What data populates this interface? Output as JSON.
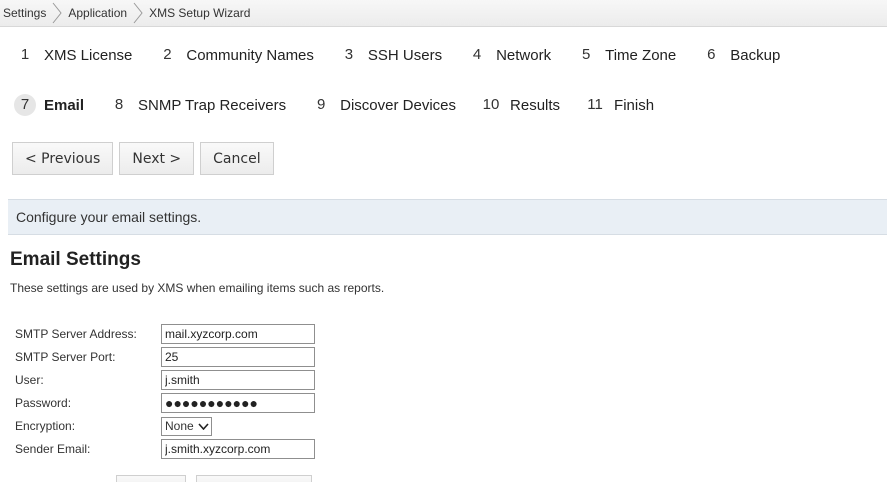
{
  "breadcrumb": {
    "items": [
      "Settings",
      "Application",
      "XMS Setup Wizard"
    ]
  },
  "steps": {
    "row1": [
      {
        "num": "1",
        "label": "XMS License"
      },
      {
        "num": "2",
        "label": "Community Names"
      },
      {
        "num": "3",
        "label": "SSH Users"
      },
      {
        "num": "4",
        "label": "Network"
      },
      {
        "num": "5",
        "label": "Time Zone"
      },
      {
        "num": "6",
        "label": "Backup"
      }
    ],
    "row2": [
      {
        "num": "7",
        "label": "Email",
        "active": true
      },
      {
        "num": "8",
        "label": "SNMP Trap Receivers"
      },
      {
        "num": "9",
        "label": "Discover Devices"
      },
      {
        "num": "10",
        "label": "Results"
      },
      {
        "num": "11",
        "label": "Finish"
      }
    ]
  },
  "nav": {
    "previous_label": "< Previous",
    "next_label": "Next >",
    "cancel_label": "Cancel"
  },
  "info_banner": "Configure your email settings.",
  "section": {
    "title": "Email Settings",
    "description": "These settings are used by XMS when emailing items such as reports."
  },
  "form": {
    "smtp_address": {
      "label": "SMTP Server Address:",
      "value": "mail.xyzcorp.com"
    },
    "smtp_port": {
      "label": "SMTP Server Port:",
      "value": "25"
    },
    "user": {
      "label": "User:",
      "value": "j.smith"
    },
    "password": {
      "label": "Password:",
      "value": "●●●●●●●●●●●"
    },
    "encryption": {
      "label": "Encryption:",
      "value": "None"
    },
    "sender_email": {
      "label": "Sender Email:",
      "value": "j.smith.xyzcorp.com"
    }
  },
  "colors": {
    "banner_bg": "#e9eff5",
    "active_step_bg": "#e6e6e6"
  }
}
